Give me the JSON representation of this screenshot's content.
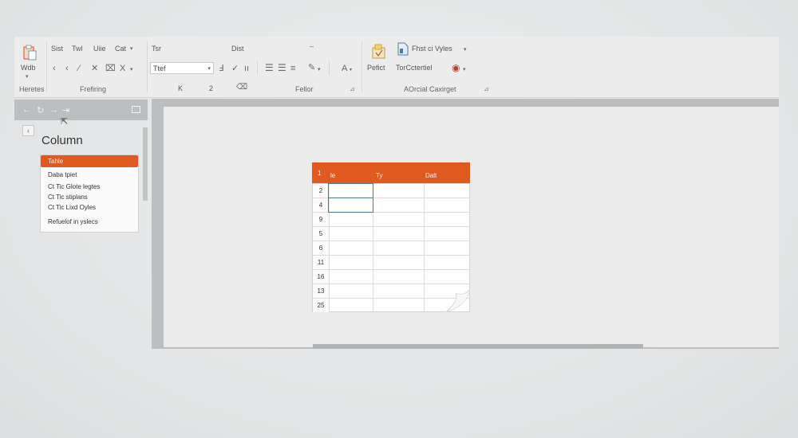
{
  "ribbon": {
    "groups": [
      {
        "name": "Heretes",
        "top_items": [
          "Wdb"
        ]
      },
      {
        "name": "Frefiring",
        "top_items": [
          "Sist",
          "Twl",
          "Uiie",
          "Cat"
        ]
      },
      {
        "name": "Fellor",
        "top_items": [
          "Tsr",
          "Dist"
        ]
      },
      {
        "name": "AOrcial Caxirget",
        "top_items": [
          "Fhst ci Vyles",
          "Pefict",
          "TorCctertiel"
        ]
      }
    ],
    "font_box": "Ttef",
    "second_row_labels": [
      "K",
      "2"
    ],
    "accent_color": "#e05a1f"
  },
  "panel": {
    "title": "Column",
    "selected": "Tahle",
    "items": [
      "Daba tpiet",
      "Ct Tic Glote legtes",
      "Ct Tic stiplans",
      "Ct Tic Lixd Oyles",
      "Refuelof in yslecs"
    ]
  },
  "sheet": {
    "header": [
      "1",
      "le",
      "Ty",
      "Dalt"
    ],
    "rows": [
      "2",
      "4",
      "9",
      "5",
      "6",
      "11",
      "16",
      "13",
      "25"
    ]
  }
}
